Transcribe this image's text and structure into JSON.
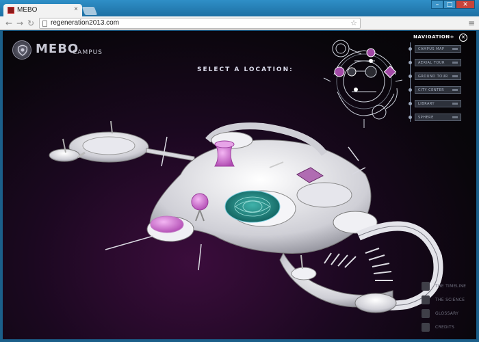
{
  "browser": {
    "tab_title": "MEBO",
    "tab_close": "×",
    "url": "regeneration2013.com",
    "nav_back": "←",
    "nav_forward": "→",
    "nav_reload": "↻",
    "star": "☆",
    "menu": "≡",
    "win_minimize": "–",
    "win_maximize": "□",
    "win_close": "✕"
  },
  "logo": {
    "title": "MEBO",
    "subtitle": "CAMPUS"
  },
  "prompt": "SELECT A LOCATION:",
  "navigation": {
    "title": "NAVIGATION+",
    "close": "✕",
    "items": [
      "CAMPUS MAP",
      "AERIAL TOUR",
      "GROUND TOUR",
      "CITY CENTER",
      "LIBRARY",
      "SPHERE"
    ]
  },
  "bottom_links": [
    {
      "label": "THE TIMELINE",
      "icon": "timeline-icon"
    },
    {
      "label": "THE SCIENCE",
      "icon": "science-icon"
    },
    {
      "label": "GLOSSARY",
      "icon": "glossary-icon"
    },
    {
      "label": "CREDITS",
      "icon": "credits-icon"
    }
  ],
  "colors": {
    "accent_magenta": "#d070d6",
    "central_teal": "#1f8a86",
    "nav_text": "#aeb6c6"
  }
}
